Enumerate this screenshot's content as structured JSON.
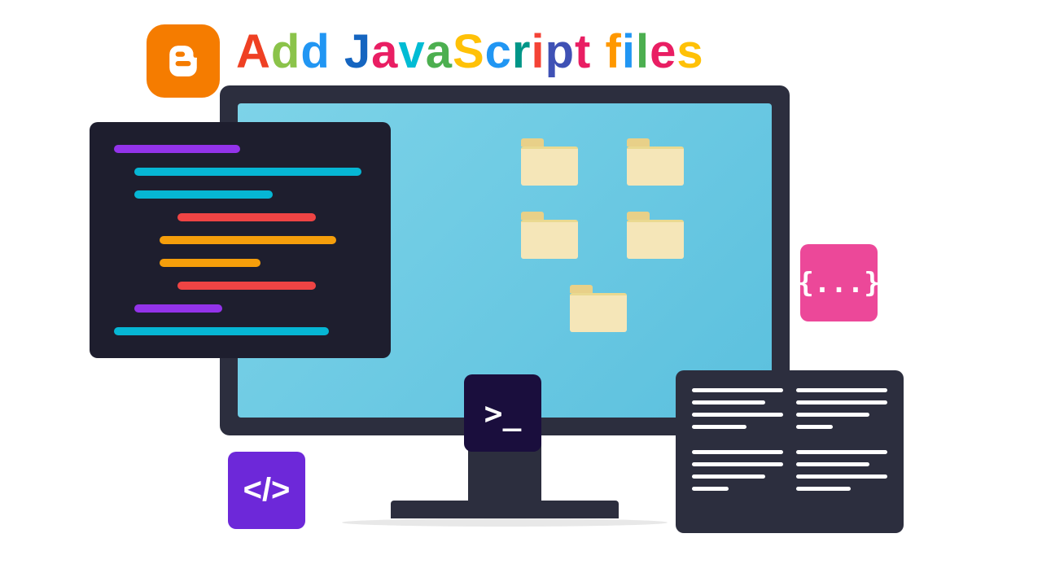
{
  "title": {
    "text": "Add JavaScript files",
    "chars": [
      "A",
      "d",
      "d",
      " ",
      "J",
      "a",
      "v",
      "a",
      "S",
      "c",
      "r",
      "i",
      "p",
      "t",
      " ",
      "f",
      "i",
      "l",
      "e",
      "s"
    ]
  },
  "icons": {
    "blogger": "blogger-logo",
    "terminal": ">_",
    "codetag": "</>",
    "json": "{...}"
  },
  "folders": {
    "count": 5
  },
  "code_lines": {
    "colors": [
      "purple",
      "cyan",
      "cyan",
      "red",
      "amber",
      "amber",
      "red",
      "purple",
      "cyan"
    ]
  }
}
